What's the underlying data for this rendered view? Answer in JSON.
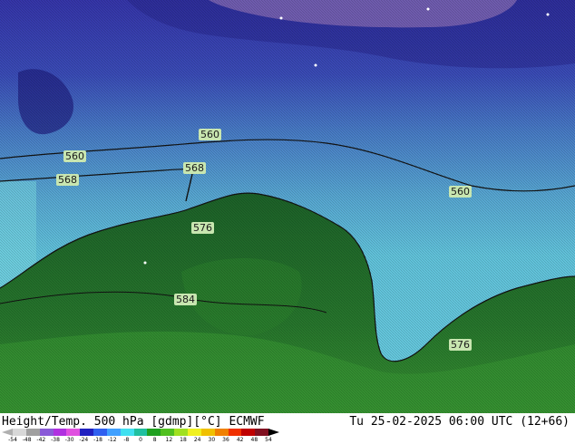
{
  "map": {
    "contour_labels": [
      "560",
      "560",
      "568",
      "568",
      "576",
      "584",
      "560",
      "576"
    ]
  },
  "footer": {
    "title_left": "Height/Temp. 500 hPa [gdmp][°C] ECMWF",
    "title_right": "Tu 25-02-2025 06:00 UTC (12+66)"
  },
  "colorbar": {
    "ticks": [
      "-54",
      "-48",
      "-42",
      "-38",
      "-30",
      "-24",
      "-18",
      "-12",
      "-8",
      "0",
      "8",
      "12",
      "18",
      "24",
      "30",
      "36",
      "42",
      "48",
      "54"
    ],
    "colors": [
      "#d8d8d8",
      "#a0a0a0",
      "#8a5ad8",
      "#b030e0",
      "#e050e0",
      "#2020c0",
      "#3060f0",
      "#40a0ff",
      "#40e0f0",
      "#20c0a0",
      "#20a020",
      "#50c020",
      "#a0e020",
      "#f0f020",
      "#f0c000",
      "#f08000",
      "#f03000",
      "#c00000",
      "#801020"
    ]
  }
}
